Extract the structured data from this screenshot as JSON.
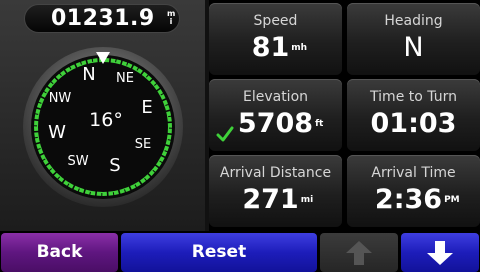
{
  "odometer": {
    "value": "01231.9",
    "unit": "mi"
  },
  "compass": {
    "heading_text": "16°",
    "labels": {
      "n": "N",
      "ne": "NE",
      "e": "E",
      "se": "SE",
      "s": "S",
      "sw": "SW",
      "w": "W",
      "nw": "NW"
    },
    "ring_color": "#3fd13a"
  },
  "fields": [
    {
      "label": "Speed",
      "value": "81",
      "unit": "mh"
    },
    {
      "label": "Heading",
      "value": "N",
      "unit": ""
    },
    {
      "label": "Elevation",
      "value": "5708",
      "unit": "ft"
    },
    {
      "label": "Time to Turn",
      "value": "01:03",
      "unit": ""
    },
    {
      "label": "Arrival Distance",
      "value": "271",
      "unit": "mi"
    },
    {
      "label": "Arrival Time",
      "value": "2:36",
      "unit": "PM"
    }
  ],
  "buttons": {
    "back": "Back",
    "reset": "Reset"
  },
  "icons": {
    "elevation_status": "check-icon",
    "scroll_up": "arrow-up-icon",
    "scroll_down": "arrow-down-icon"
  },
  "colors": {
    "back_button": "#6a1f8c",
    "reset_button": "#1f1fc0",
    "check": "#3fd13a"
  }
}
